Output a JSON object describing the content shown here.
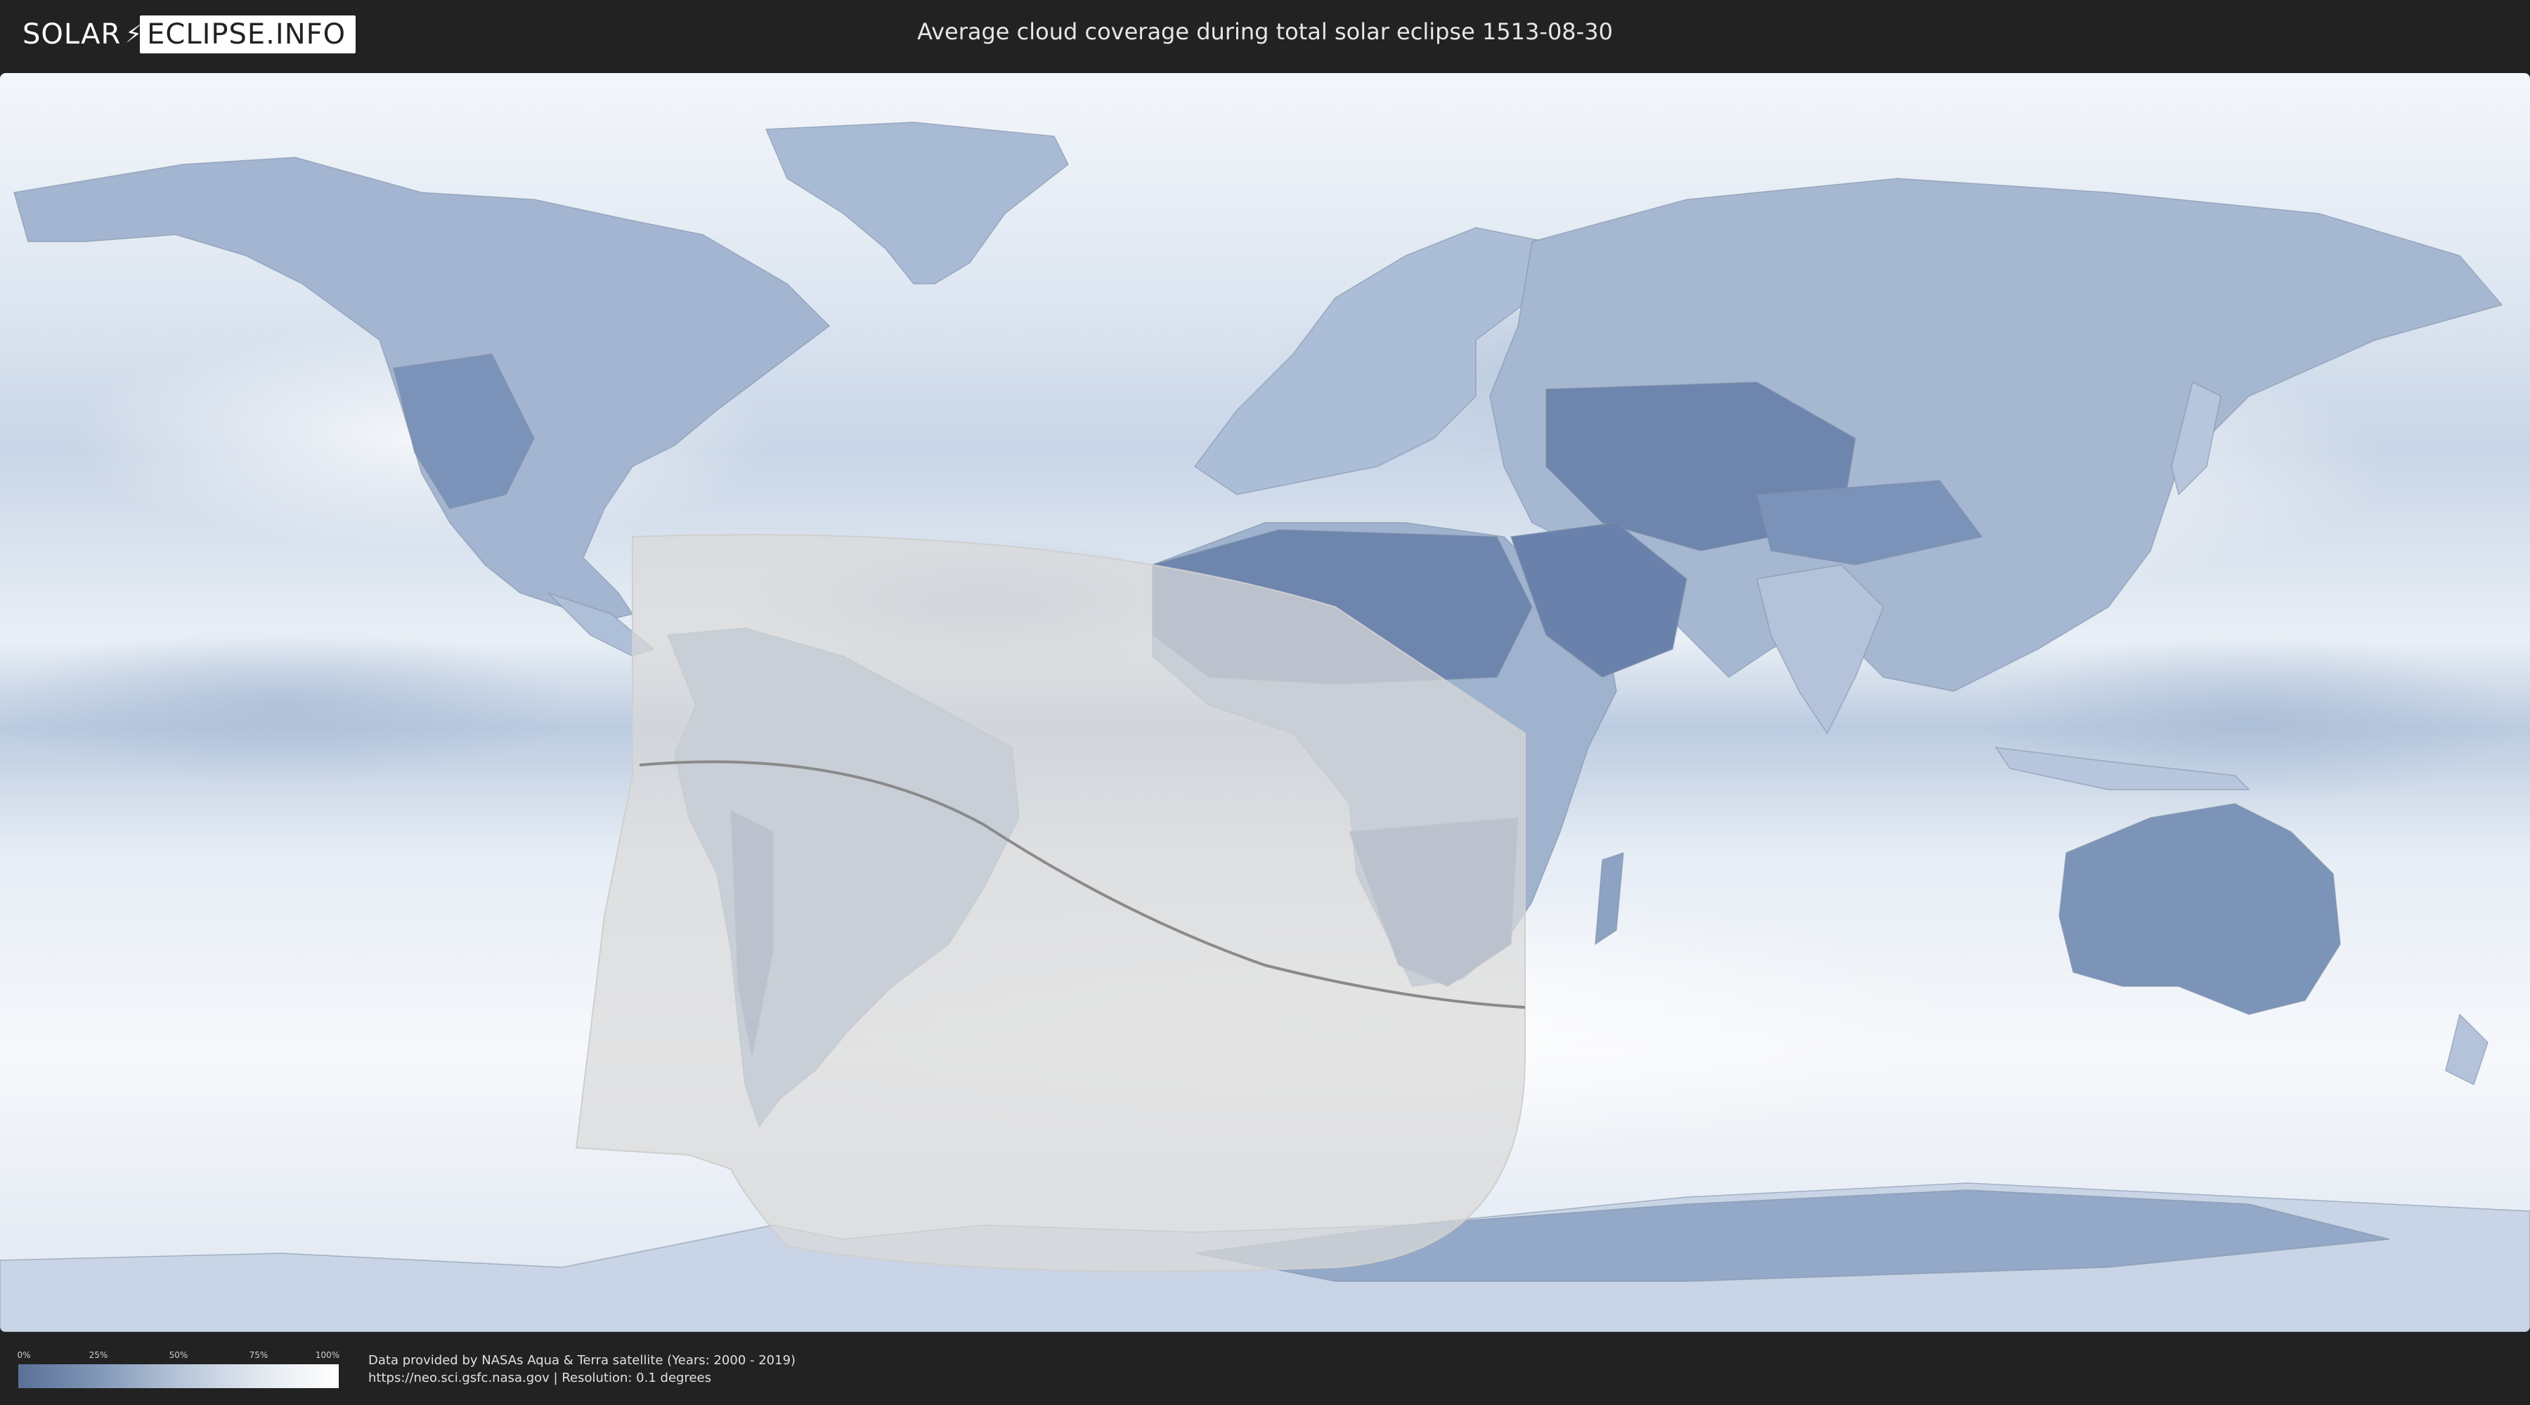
{
  "header": {
    "logo_left": "SOLAR",
    "logo_right": "ECLIPSE.INFO",
    "title": "Average cloud coverage during total solar eclipse 1513-08-30"
  },
  "legend": {
    "ticks": [
      "0%",
      "25%",
      "50%",
      "75%",
      "100%"
    ],
    "colors": [
      "#5a7096",
      "#8197b8",
      "#b6c4d8",
      "#e2e8f0",
      "#ffffff"
    ]
  },
  "footer": {
    "source_line": "Data provided by NASAs Aqua & Terra satellite (Years: 2000 - 2019)",
    "url_line": "https://neo.sci.gsfc.nasa.gov | Resolution: 0.1 degrees"
  },
  "map": {
    "cloud_color_low": "#5a7096",
    "cloud_color_high": "#ffffff",
    "eclipse_zone_color": "#d9d9d9",
    "central_line_color": "#8a8a8a"
  }
}
